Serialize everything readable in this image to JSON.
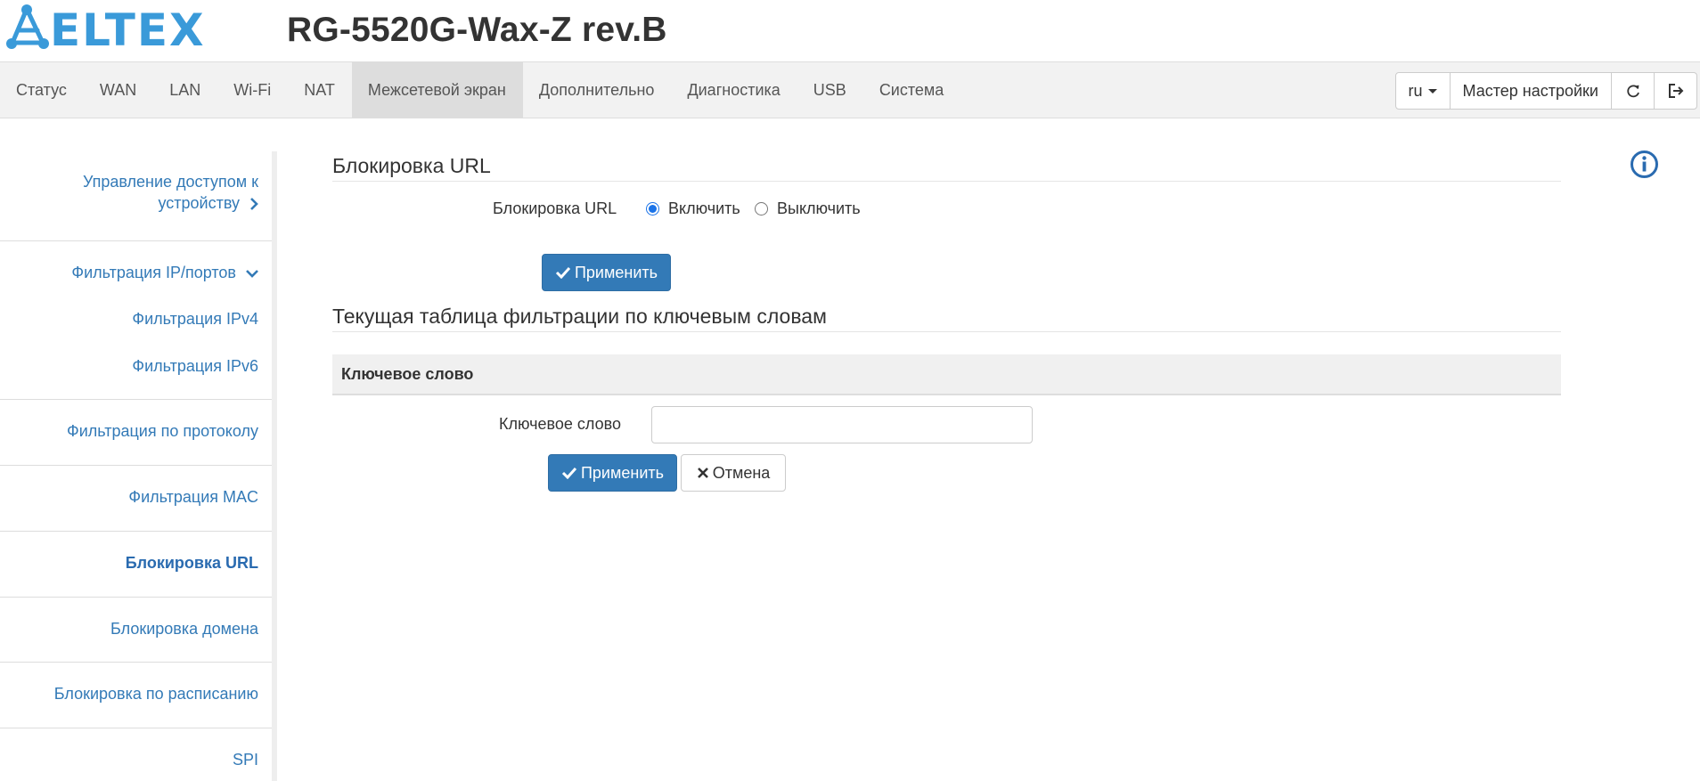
{
  "header": {
    "brand": "ELTEX",
    "device_title": "RG-5520G-Wax-Z rev.B",
    "logo_color": "#3a9ad9"
  },
  "topnav": {
    "tabs": [
      {
        "label": "Статус",
        "active": false
      },
      {
        "label": "WAN",
        "active": false
      },
      {
        "label": "LAN",
        "active": false
      },
      {
        "label": "Wi-Fi",
        "active": false
      },
      {
        "label": "NAT",
        "active": false
      },
      {
        "label": "Межсетевой экран",
        "active": true
      },
      {
        "label": "Дополнительно",
        "active": false
      },
      {
        "label": "Диагностика",
        "active": false
      },
      {
        "label": "USB",
        "active": false
      },
      {
        "label": "Система",
        "active": false
      }
    ],
    "language": "ru",
    "wizard_label": "Мастер настройки",
    "refresh_icon": "refresh-icon",
    "logout_icon": "logout-icon"
  },
  "sidebar": {
    "items": [
      {
        "label_line1": "Управление доступом к",
        "label_line2": "устройству",
        "icon": "chevron-right-icon"
      },
      {
        "label": "Фильтрация IP/портов",
        "icon": "chevron-down-icon"
      },
      {
        "label": "Фильтрация IPv4"
      },
      {
        "label": "Фильтрация IPv6"
      },
      {
        "label": "Фильтрация по протоколу"
      },
      {
        "label": "Фильтрация MAC"
      },
      {
        "label": "Блокировка URL",
        "active": true
      },
      {
        "label": "Блокировка домена"
      },
      {
        "label": "Блокировка по расписанию"
      },
      {
        "label": "SPI"
      }
    ]
  },
  "main": {
    "section1_title": "Блокировка URL",
    "url_block_label": "Блокировка URL",
    "radio_on_label": "Включить",
    "radio_off_label": "Выключить",
    "radio_selected": "on",
    "apply_label": "Применить",
    "section2_title": "Текущая таблица фильтрации по ключевым словам",
    "table_header": "Ключевое слово",
    "keyword_label": "Ключевое слово",
    "keyword_value": "",
    "keyword_placeholder": "",
    "apply2_label": "Применить",
    "cancel_label": "Отмена",
    "info_icon": "info-icon"
  },
  "colors": {
    "accent": "#337ab7",
    "link": "#337ab7",
    "radio": "#1a73e8"
  }
}
